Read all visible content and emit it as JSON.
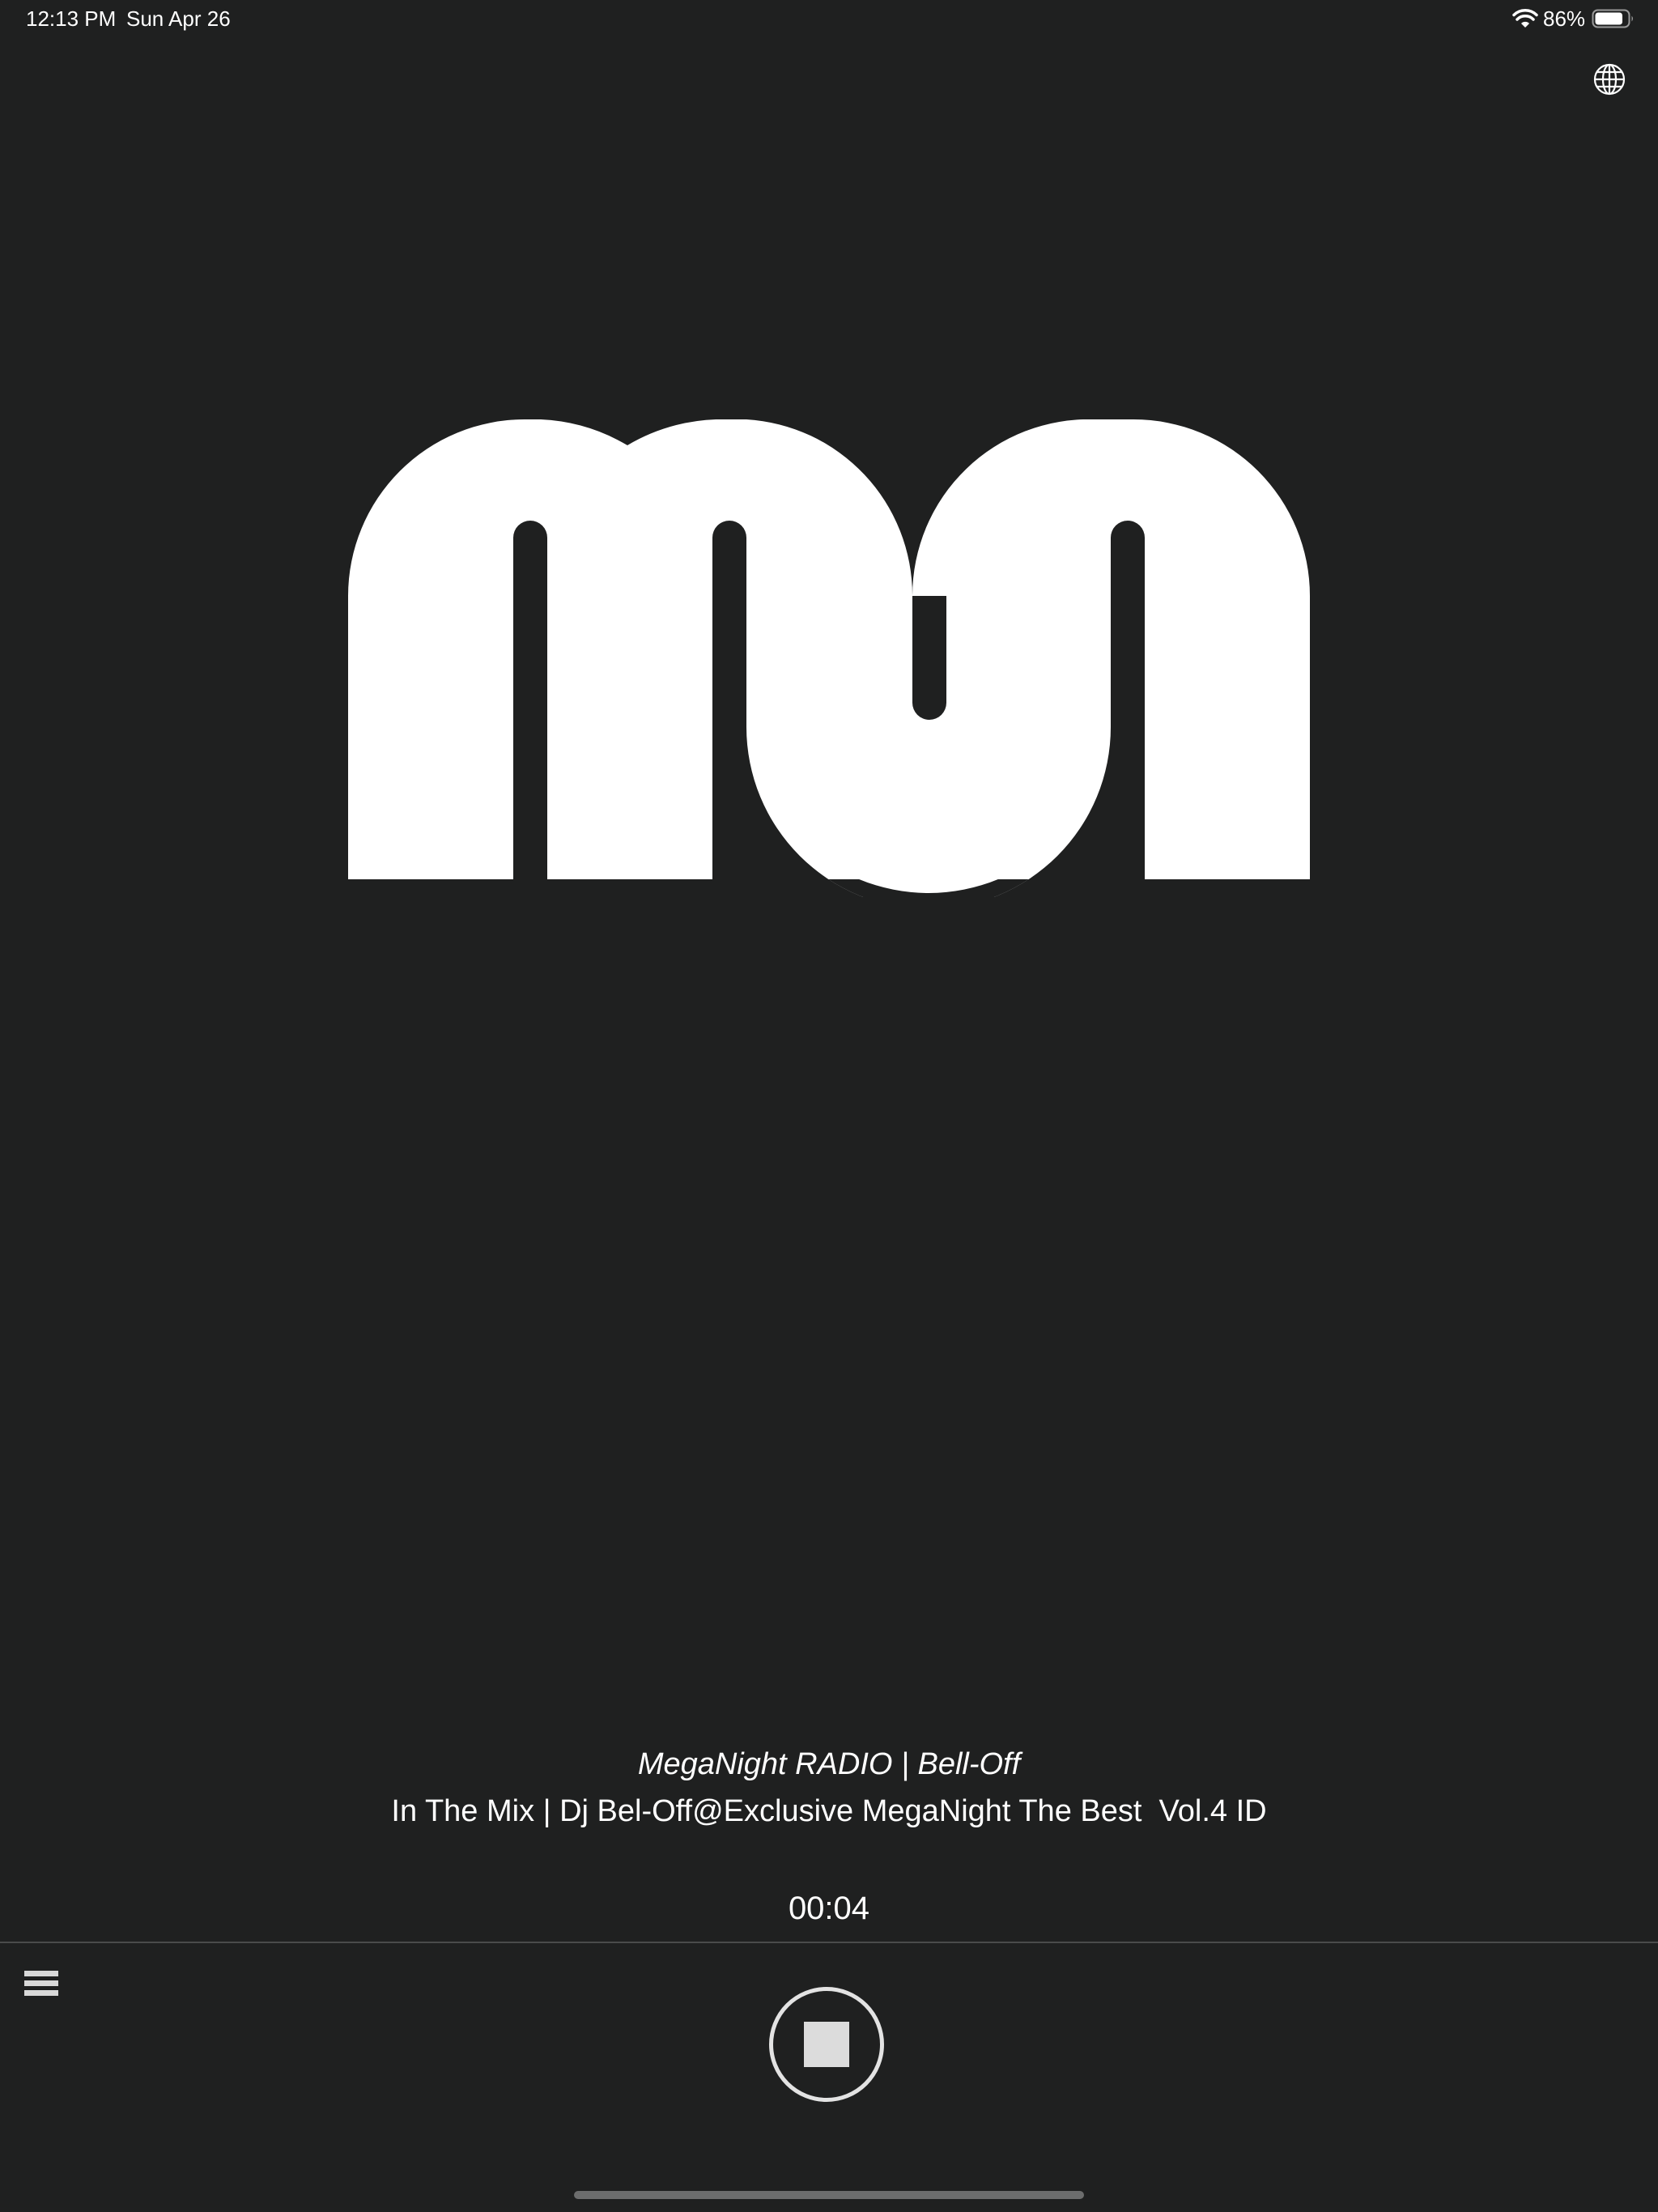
{
  "status_bar": {
    "time": "12:13 PM",
    "date": "Sun Apr 26",
    "battery_percent": "86%",
    "battery_level": 0.86,
    "wifi_icon": "wifi-icon",
    "battery_icon": "battery-icon"
  },
  "header": {
    "language_icon": "globe-icon"
  },
  "logo": {
    "icon": "meganight-logo",
    "color": "#ffffff"
  },
  "now_playing": {
    "station": "MegaNight RADIO | Bell-Off",
    "track": "In The Mix | Dj Bel-Off@Exclusive MegaNight The Best  Vol.4 ID",
    "elapsed": "00:04"
  },
  "controls": {
    "menu_icon": "hamburger-menu-icon",
    "stop_icon": "stop-icon"
  },
  "colors": {
    "background": "#1f2020",
    "text": "#ffffff",
    "divider": "#4a4b4b",
    "control": "#dcdcdc"
  }
}
